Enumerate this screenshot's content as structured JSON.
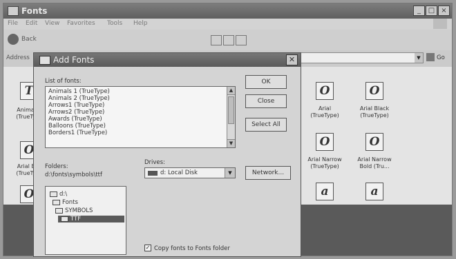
{
  "window": {
    "title": "Fonts",
    "menu": [
      "File",
      "Edit",
      "View",
      "Favorites",
      "Tools",
      "Help"
    ],
    "back_label": "Back",
    "address_label": "Address",
    "go_label": "Go"
  },
  "fonts": [
    {
      "name": "Animals 1",
      "type": "(TrueType)"
    },
    {
      "name": "Arial Bo...",
      "type": "(TrueTyp..."
    },
    {
      "name": "Arial",
      "type": "(TrueType)"
    },
    {
      "name": "Arial Black",
      "type": "(TrueType)"
    },
    {
      "name": "Arial Narrow",
      "type": "(TrueType)"
    },
    {
      "name": "Arial Narrow",
      "type": "Bold (Tru..."
    }
  ],
  "dialog": {
    "title": "Add Fonts",
    "list_label": "List of fonts:",
    "font_list": [
      "Animals 1 (TrueType)",
      "Animals 2 (TrueType)",
      "Arrows1 (TrueType)",
      "Arrows2 (TrueType)",
      "Awards (TrueType)",
      "Balloons (TrueType)",
      "Borders1 (TrueType)"
    ],
    "ok_label": "OK",
    "close_label": "Close",
    "select_all_label": "Select All",
    "folders_label": "Folders:",
    "folder_path": "d:\\fonts\\symbols\\ttf",
    "folders": [
      "d:\\",
      "Fonts",
      "SYMBOLS",
      "TTF"
    ],
    "drives_label": "Drives:",
    "drive_value": "d: Local Disk",
    "network_label": "Network...",
    "copy_label": "Copy fonts to Fonts folder",
    "copy_checked": true
  }
}
